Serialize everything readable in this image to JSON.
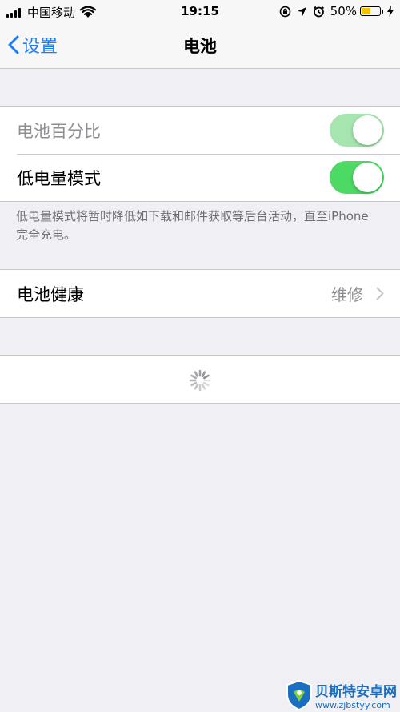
{
  "status_bar": {
    "carrier": "中国移动",
    "time": "19:15",
    "battery_percent": "50%",
    "battery_level": 0.5
  },
  "nav": {
    "back_label": "设置",
    "title": "电池"
  },
  "settings": {
    "battery_percentage": {
      "label": "电池百分比",
      "on": true,
      "enabled": false
    },
    "low_power_mode": {
      "label": "低电量模式",
      "on": true,
      "enabled": true
    },
    "footer": "低电量模式将暂时降低如下载和邮件获取等后台活动，直至iPhone 完全充电。"
  },
  "battery_health": {
    "label": "电池健康",
    "value": "维修"
  },
  "watermark": {
    "name": "贝斯特安卓网",
    "url": "www.zjbstyy.com"
  },
  "colors": {
    "accent": "#1a7cfa",
    "toggle_on": "#4cd964",
    "toggle_disabled": "#a6e4b0",
    "background": "#efeff4"
  }
}
